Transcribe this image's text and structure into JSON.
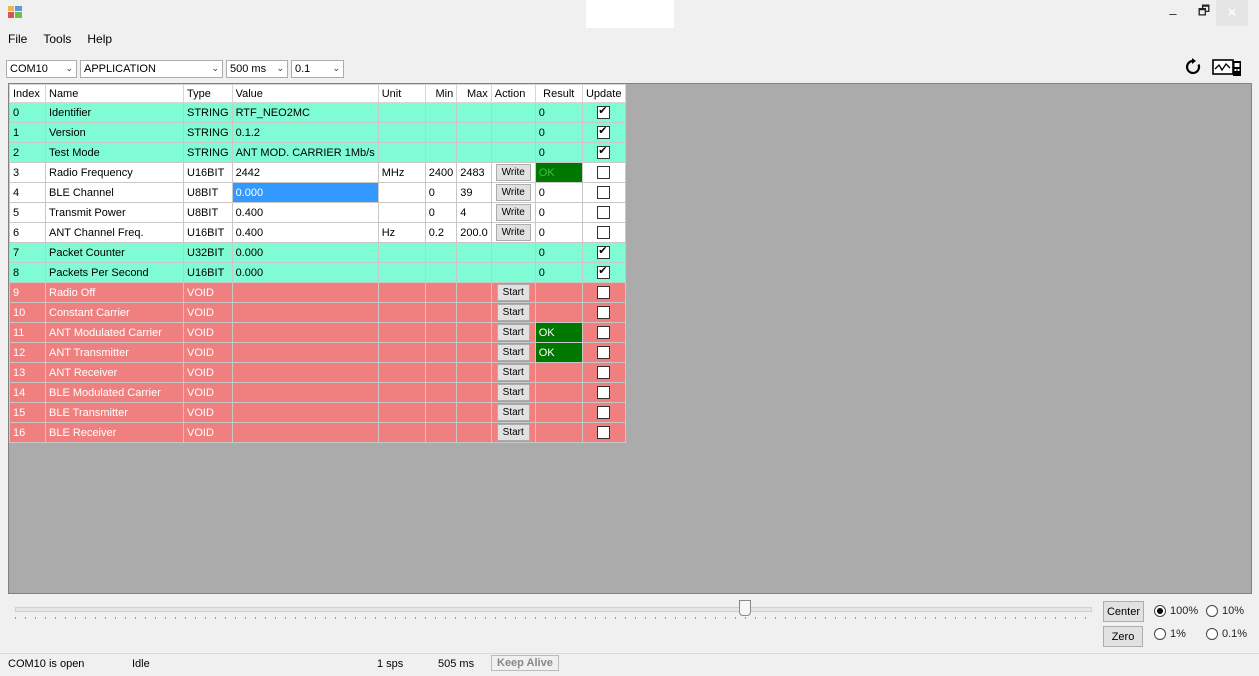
{
  "window": {
    "min_label": "–",
    "max_label": "🗗",
    "close_label": "✕"
  },
  "menu": [
    "File",
    "Tools",
    "Help"
  ],
  "toolbar": {
    "port": "COM10",
    "mode": "APPLICATION",
    "interval": "500 ms",
    "scale": "0.1",
    "refresh_icon": "refresh-icon",
    "scope_icon": "scope-icon"
  },
  "table": {
    "headers": [
      "Index",
      "Name",
      "Type",
      "Value",
      "Unit",
      "Min",
      "Max",
      "Action",
      "Result",
      "Update"
    ],
    "rows": [
      {
        "style": "g",
        "index": "0",
        "name": "Identifier",
        "type": "STRING",
        "value": "RTF_NEO2MC",
        "unit": "",
        "min": "",
        "max": "",
        "action": "",
        "result": "0",
        "update": true
      },
      {
        "style": "g",
        "index": "1",
        "name": "Version",
        "type": "STRING",
        "value": "0.1.2",
        "unit": "",
        "min": "",
        "max": "",
        "action": "",
        "result": "0",
        "update": true
      },
      {
        "style": "g",
        "index": "2",
        "name": "Test Mode",
        "type": "STRING",
        "value": "ANT MOD. CARRIER 1Mb/s",
        "unit": "",
        "min": "",
        "max": "",
        "action": "",
        "result": "0",
        "update": true
      },
      {
        "style": "w",
        "index": "3",
        "name": "Radio Frequency",
        "type": "U16BIT",
        "value": "2442",
        "unit": "MHz",
        "min": "2400",
        "max": "2483",
        "action": "Write",
        "result": "OK",
        "update": false
      },
      {
        "style": "w",
        "index": "4",
        "name": "BLE Channel",
        "type": "U8BIT",
        "value": "0.000",
        "unit": "",
        "min": "0",
        "max": "39",
        "action": "Write",
        "result": "0",
        "update": false,
        "selected": true
      },
      {
        "style": "w",
        "index": "5",
        "name": "Transmit Power",
        "type": "U8BIT",
        "value": "0.400",
        "unit": "",
        "min": "0",
        "max": "4",
        "action": "Write",
        "result": "0",
        "update": false
      },
      {
        "style": "w",
        "index": "6",
        "name": "ANT Channel Freq.",
        "type": "U16BIT",
        "value": "0.400",
        "unit": "Hz",
        "min": "0.2",
        "max": "200.0",
        "action": "Write",
        "result": "0",
        "update": false
      },
      {
        "style": "g",
        "index": "7",
        "name": "Packet Counter",
        "type": "U32BIT",
        "value": "0.000",
        "unit": "",
        "min": "",
        "max": "",
        "action": "",
        "result": "0",
        "update": true
      },
      {
        "style": "g",
        "index": "8",
        "name": "Packets Per Second",
        "type": "U16BIT",
        "value": "0.000",
        "unit": "",
        "min": "",
        "max": "",
        "action": "",
        "result": "0",
        "update": true
      },
      {
        "style": "r",
        "index": "9",
        "name": "Radio Off",
        "type": "VOID",
        "value": "",
        "unit": "",
        "min": "",
        "max": "",
        "action": "Start",
        "result": "",
        "update": false
      },
      {
        "style": "r",
        "index": "10",
        "name": "Constant Carrier",
        "type": "VOID",
        "value": "",
        "unit": "",
        "min": "",
        "max": "",
        "action": "Start",
        "result": "",
        "update": false
      },
      {
        "style": "r",
        "index": "11",
        "name": "ANT Modulated Carrier",
        "type": "VOID",
        "value": "",
        "unit": "",
        "min": "",
        "max": "",
        "action": "Start",
        "result": "OK",
        "update": false
      },
      {
        "style": "r",
        "index": "12",
        "name": "ANT Transmitter",
        "type": "VOID",
        "value": "",
        "unit": "",
        "min": "",
        "max": "",
        "action": "Start",
        "result": "OK",
        "update": false
      },
      {
        "style": "r",
        "index": "13",
        "name": "ANT Receiver",
        "type": "VOID",
        "value": "",
        "unit": "",
        "min": "",
        "max": "",
        "action": "Start",
        "result": "",
        "update": false
      },
      {
        "style": "r",
        "index": "14",
        "name": "BLE Modulated Carrier",
        "type": "VOID",
        "value": "",
        "unit": "",
        "min": "",
        "max": "",
        "action": "Start",
        "result": "",
        "update": false
      },
      {
        "style": "r",
        "index": "15",
        "name": "BLE Transmitter",
        "type": "VOID",
        "value": "",
        "unit": "",
        "min": "",
        "max": "",
        "action": "Start",
        "result": "",
        "update": false
      },
      {
        "style": "r",
        "index": "16",
        "name": "BLE Receiver",
        "type": "VOID",
        "value": "",
        "unit": "",
        "min": "",
        "max": "",
        "action": "Start",
        "result": "",
        "update": false
      }
    ]
  },
  "slider": {
    "position": 0.68
  },
  "controls": {
    "center_label": "Center",
    "zero_label": "Zero",
    "radios": [
      {
        "label": "100%",
        "checked": true
      },
      {
        "label": "10%",
        "checked": false
      },
      {
        "label": "1%",
        "checked": false
      },
      {
        "label": "0.1%",
        "checked": false
      }
    ]
  },
  "status": {
    "port_status": "COM10 is open",
    "state": "Idle",
    "rate": "1 sps",
    "latency": "505 ms",
    "keep_alive": "Keep Alive"
  }
}
